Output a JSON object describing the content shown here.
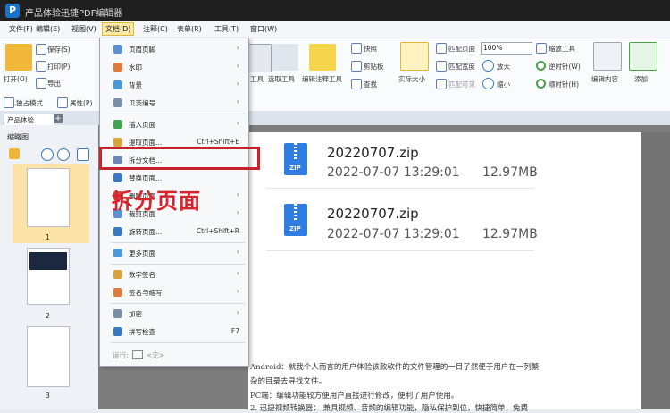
{
  "app": {
    "title": "产品体验迅捷PDF编辑器",
    "logo": "P"
  },
  "menubar": [
    "文件(F)",
    "编辑(E)",
    "视图(V)",
    "文档(D)",
    "注释(C)",
    "表单(R)",
    "工具(T)",
    "窗口(W)"
  ],
  "ribbon": {
    "left": {
      "open": "打开(O)",
      "save": "保存(S)",
      "print": "打印(P)",
      "export": "导出",
      "standalone": "独占模式",
      "properties": "属性(P)"
    },
    "tools": {
      "hand": "工具",
      "select_text": "选取工具",
      "edit_annot": "编辑注释工具",
      "snapshot": "快照",
      "clipboard": "剪贴板",
      "find": "查找",
      "actual_size": "实际大小",
      "fit_page": "匹配页面",
      "fit_width": "匹配宽度",
      "fit_visible": "匹配可见",
      "zoom_value": "100%",
      "zoom_in": "放大",
      "zoom_out": "缩小",
      "zoom_tool": "缩放工具",
      "rotate_ccw": "逆时针(W)",
      "rotate_cw": "顺时针(H)",
      "edit_content": "编辑内容",
      "add": "添加"
    }
  },
  "tab": {
    "label": "产品体验",
    "add": "+"
  },
  "thumbnails": {
    "title": "缩略图",
    "pages": [
      "1",
      "2",
      "3"
    ]
  },
  "document": {
    "files": [
      {
        "name": "20220707.zip",
        "date": "2022-07-07 13:29:01",
        "size": "12.97MB"
      },
      {
        "name": "20220707.zip",
        "date": "2022-07-07 13:29:01",
        "size": "12.97MB"
      }
    ],
    "zip_label": "ZIP",
    "paragraphs": [
      "Android：就我个人而言的用户体验该款软件的文件管理的一目了然便于用户在一列繁",
      "杂的目录去寻找文件。",
      "PC端：编辑功能较方便用户直接进行修改，便利了用户使用。",
      "2.     迅捷视频转换器：  兼具视频、音频的编辑功能，隐私保护到位，快捷简单，免费"
    ]
  },
  "dropdown": {
    "items": [
      {
        "label": "页眉页脚",
        "arrow": "›",
        "shortcut": ""
      },
      {
        "label": "水印",
        "arrow": "›",
        "shortcut": ""
      },
      {
        "label": "背景",
        "arrow": "›",
        "shortcut": ""
      },
      {
        "label": "贝茨编号",
        "arrow": "›",
        "shortcut": ""
      },
      {
        "label": "插入页面",
        "arrow": "›",
        "shortcut": ""
      },
      {
        "label": "提取页面...",
        "arrow": "",
        "shortcut": "Ctrl+Shift+E"
      },
      {
        "label": "拆分文档...",
        "arrow": "",
        "shortcut": ""
      },
      {
        "label": "替换页面...",
        "arrow": "",
        "shortcut": ""
      },
      {
        "label": "删除页面",
        "arrow": "›",
        "shortcut": ""
      },
      {
        "label": "裁剪页面",
        "arrow": "›",
        "shortcut": ""
      },
      {
        "label": "旋转页面...",
        "arrow": "",
        "shortcut": "Ctrl+Shift+R"
      },
      {
        "label": "更多页面",
        "arrow": "›",
        "shortcut": ""
      },
      {
        "label": "数字签名",
        "arrow": "›",
        "shortcut": ""
      },
      {
        "label": "签名与缩写",
        "arrow": "›",
        "shortcut": ""
      },
      {
        "label": "加密",
        "arrow": "›",
        "shortcut": ""
      },
      {
        "label": "拼写检查",
        "arrow": "",
        "shortcut": "F7"
      }
    ],
    "footer": {
      "label": "运行:",
      "value": "<无>"
    }
  },
  "annotation": "拆分页面",
  "colors": {
    "accent_red": "#c8232c",
    "menu_active": "#ffe9a6",
    "zip_blue": "#2f7de0"
  }
}
